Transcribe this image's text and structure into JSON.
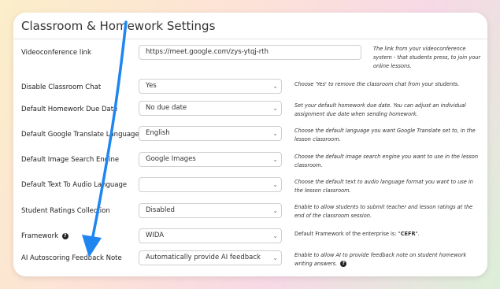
{
  "page_title": "Classroom & Homework Settings",
  "settings": [
    {
      "label": "Videoconference link",
      "value": "https://meet.google.com/zys-ytqj-rth",
      "help": "The link from your videoconference system - that students press, to join your online lessons."
    },
    {
      "label": "Disable Classroom Chat",
      "value": "Yes",
      "help": "Choose 'Yes' to remove the classroom chat from your students."
    },
    {
      "label": "Default Homework Due Date",
      "value": "No due date",
      "help": "Set your default homework due date. You can adjust an individual assignment due date when sending homework."
    },
    {
      "label": "Default Google Translate Language",
      "value": "English",
      "help": "Choose the default language you want Google Translate set to, in the lesson classroom."
    },
    {
      "label": "Default Image Search Engine",
      "value": "Google Images",
      "help": "Choose the default image search engine you want to use in the lesson classroom."
    },
    {
      "label": "Default Text To Audio Language",
      "value": "",
      "help": "Choose the default text to audio language format you want to use in the lesson classroom."
    },
    {
      "label": "Student Ratings Collection",
      "value": "Disabled",
      "help": "Enable to allow students to submit teacher and lesson ratings at the end of the classroom session."
    },
    {
      "label": "Framework",
      "value": "WIDA",
      "help_prefix": "Default Framework of the enterprise is: \"",
      "help_bold": "CEFR",
      "help_suffix": "\"."
    },
    {
      "label": "AI Autoscoring Feedback Note",
      "value": "Automatically provide AI feedback",
      "help": "Enable to allow AI to provide feedback note on student homework writing answers."
    }
  ],
  "arrow_color": "#1f86f0"
}
